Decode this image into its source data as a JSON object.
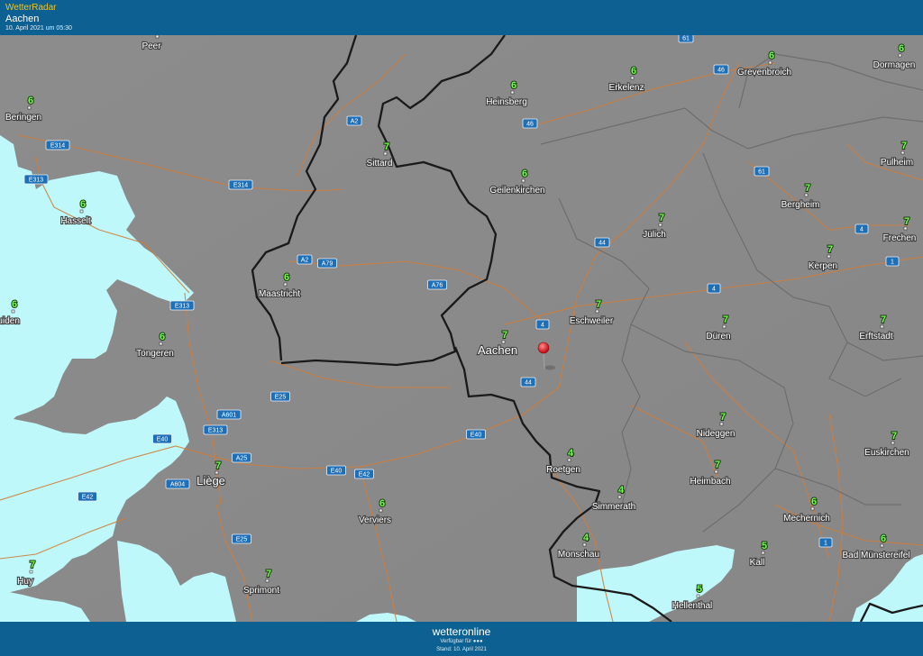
{
  "header": {
    "app_name": "WetterRadar",
    "location": "Aachen",
    "timestamp": "10. April 2021 um 05:30"
  },
  "footer": {
    "brand": "wetteronline",
    "available_label": "Verfügbar für",
    "stand": "Stand: 10. April 2021"
  },
  "colors": {
    "header_bg": "#0d6192",
    "rain_area": "#bff8fa",
    "border": "#1a1a1a",
    "road": "#cf7d3b",
    "temp_text": "#71ff4a",
    "pin": "#e3151b"
  },
  "map": {
    "marker": {
      "name": "location-pin-icon",
      "label": "Aachen"
    },
    "towns": [
      {
        "name": "Peer",
        "temp": "",
        "big": false
      },
      {
        "name": "Beringen",
        "temp": "6",
        "big": false
      },
      {
        "name": "Hasselt",
        "temp": "6",
        "big": false
      },
      {
        "name": "ruiden",
        "temp": "6",
        "big": false
      },
      {
        "name": "Tongeren",
        "temp": "6",
        "big": false
      },
      {
        "name": "Maastricht",
        "temp": "6",
        "big": false
      },
      {
        "name": "Sittard",
        "temp": "7",
        "big": false
      },
      {
        "name": "Heinsberg",
        "temp": "6",
        "big": false
      },
      {
        "name": "Erkelenz",
        "temp": "6",
        "big": false
      },
      {
        "name": "Grevenbroich",
        "temp": "6",
        "big": false
      },
      {
        "name": "Dormagen",
        "temp": "6",
        "big": false
      },
      {
        "name": "Geilenkirchen",
        "temp": "6",
        "big": false
      },
      {
        "name": "Pulheim",
        "temp": "7",
        "big": false
      },
      {
        "name": "Bergheim",
        "temp": "7",
        "big": false
      },
      {
        "name": "Jülich",
        "temp": "7",
        "big": false
      },
      {
        "name": "Frechen",
        "temp": "7",
        "big": false
      },
      {
        "name": "Kerpen",
        "temp": "7",
        "big": false
      },
      {
        "name": "Eschweiler",
        "temp": "7",
        "big": false
      },
      {
        "name": "Aachen",
        "temp": "7",
        "big": true
      },
      {
        "name": "Düren",
        "temp": "7",
        "big": false
      },
      {
        "name": "Erftstadt",
        "temp": "7",
        "big": false
      },
      {
        "name": "Liège",
        "temp": "7",
        "big": true
      },
      {
        "name": "Verviers",
        "temp": "6",
        "big": false
      },
      {
        "name": "Roetgen",
        "temp": "4",
        "big": false
      },
      {
        "name": "Nideggen",
        "temp": "7",
        "big": false
      },
      {
        "name": "Euskirchen",
        "temp": "7",
        "big": false
      },
      {
        "name": "Simmerath",
        "temp": "4",
        "big": false
      },
      {
        "name": "Heimbach",
        "temp": "7",
        "big": false
      },
      {
        "name": "Mechernich",
        "temp": "6",
        "big": false
      },
      {
        "name": "Monschau",
        "temp": "4",
        "big": false
      },
      {
        "name": "Kall",
        "temp": "5",
        "big": false
      },
      {
        "name": "Bad Münstereifel",
        "temp": "6",
        "big": false
      },
      {
        "name": "Hellenthal",
        "temp": "5",
        "big": false
      },
      {
        "name": "Huy",
        "temp": "7",
        "big": false
      },
      {
        "name": "Sprimont",
        "temp": "7",
        "big": false
      }
    ],
    "road_shields": [
      "61",
      "46",
      "A2",
      "E314",
      "E313",
      "E314",
      "46",
      "61",
      "A2",
      "A79",
      "A76",
      "4",
      "44",
      "E313",
      "4",
      "4",
      "E25",
      "A601",
      "E313",
      "1",
      "44",
      "E40",
      "E40",
      "A25",
      "A604",
      "E42",
      "E40",
      "E42",
      "E25",
      "1"
    ]
  }
}
